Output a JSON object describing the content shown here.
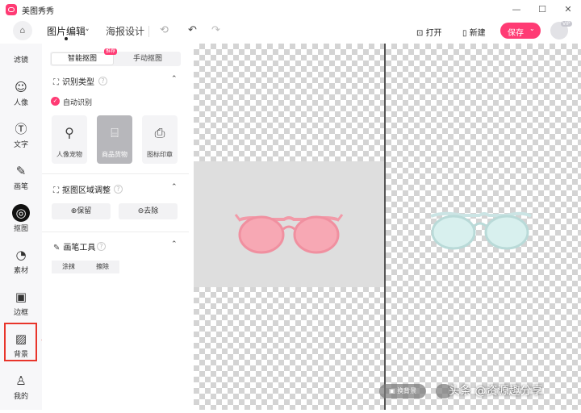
{
  "app": {
    "title": "美图秀秀"
  },
  "window": {
    "minimize": "—",
    "maximize": "☐",
    "close": "✕"
  },
  "toolbar": {
    "home_icon": "⌂",
    "tab_edit": "图片编辑",
    "tab_edit_chevron": "˅",
    "tab_poster": "海报设计",
    "history_icon": "⟲",
    "undo_icon": "↶",
    "redo_icon": "↷",
    "open_label": "打开",
    "new_label": "新建",
    "save_label": "保存",
    "save_chevron": "⌄",
    "vip_label": "VIP"
  },
  "rail": {
    "items": [
      {
        "label": "滤镜",
        "icon": "filter-icon",
        "glyph": ""
      },
      {
        "label": "人像",
        "icon": "portrait-icon",
        "glyph": "☺"
      },
      {
        "label": "文字",
        "icon": "text-icon",
        "glyph": "Ⓣ"
      },
      {
        "label": "画笔",
        "icon": "brush-icon",
        "glyph": "✎"
      },
      {
        "label": "抠图",
        "icon": "cutout-icon",
        "glyph": "◎",
        "active": true
      },
      {
        "label": "素材",
        "icon": "sticker-icon",
        "glyph": "◔"
      },
      {
        "label": "边框",
        "icon": "frame-icon",
        "glyph": "▣"
      },
      {
        "label": "背景",
        "icon": "background-icon",
        "glyph": "▨"
      },
      {
        "label": "我的",
        "icon": "user-icon",
        "glyph": "♙"
      }
    ]
  },
  "panel": {
    "seg_smart": "智能抠图",
    "seg_smart_tag": "推荐",
    "seg_manual": "手动抠图",
    "sec1_title": "识别类型",
    "sec1_icon": "⛶",
    "help": "?",
    "caret": "⌃",
    "auto_label": "自动识别",
    "check_glyph": "✓",
    "types": [
      {
        "label": "人像宠物",
        "glyph": "⚲"
      },
      {
        "label": "商品货物",
        "glyph": "⌸"
      },
      {
        "label": "图标印章",
        "glyph": "⎙"
      }
    ],
    "sec2_title": "抠图区域调整",
    "sec2_icon": "⛶",
    "keep_label": "保留",
    "keep_icon": "⊕",
    "remove_label": "去除",
    "remove_icon": "⊖",
    "sec3_title": "画笔工具",
    "sec3_icon": "✎",
    "smear_label": "涂抹",
    "erase_label": "擦除"
  },
  "canvas": {
    "change_bg_label": "换背景",
    "change_bg_icon": "▣",
    "watermark": "头条 @资源趣分享"
  },
  "colors": {
    "accent": "#ff3b74",
    "highlight": "#e8352b"
  }
}
